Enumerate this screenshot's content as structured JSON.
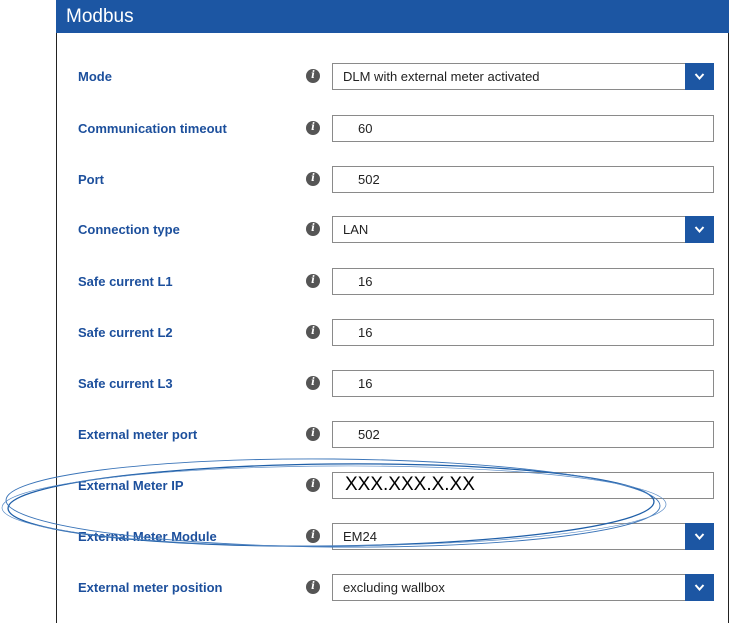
{
  "header": {
    "title": "Modbus"
  },
  "rows": [
    {
      "label": "Mode",
      "type": "select",
      "value": "DLM with external meter activated"
    },
    {
      "label": "Communication timeout",
      "type": "input",
      "value": "60"
    },
    {
      "label": "Port",
      "type": "input",
      "value": "502"
    },
    {
      "label": "Connection type",
      "type": "select",
      "value": "LAN"
    },
    {
      "label": "Safe current L1",
      "type": "input",
      "value": "16"
    },
    {
      "label": "Safe current L2",
      "type": "input",
      "value": "16"
    },
    {
      "label": "Safe current L3",
      "type": "input",
      "value": "16"
    },
    {
      "label": "External meter port",
      "type": "input",
      "value": "502"
    },
    {
      "label": "External Meter IP",
      "type": "input",
      "value": "XXX.XXX.X.XX"
    },
    {
      "label": "External Meter Module",
      "type": "select",
      "value": "EM24"
    },
    {
      "label": "External meter position",
      "type": "select",
      "value": "excluding wallbox"
    }
  ],
  "icons": {
    "info": "info-icon",
    "dropdown": "chevron-down-icon"
  },
  "colors": {
    "accent": "#1c56a3",
    "label": "#1c4f9c",
    "annotation": "#1f5fa8"
  }
}
